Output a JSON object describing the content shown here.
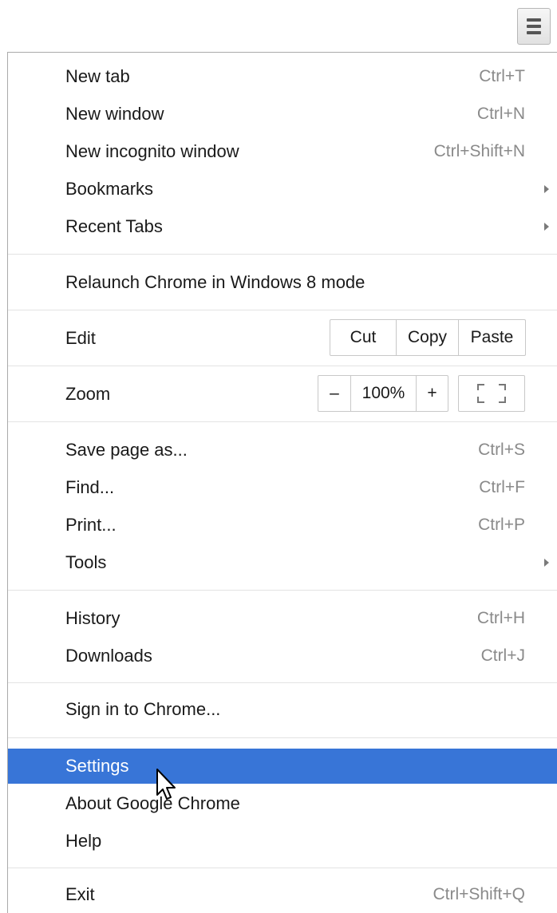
{
  "toolbar": {
    "menu_button": "hamburger-menu"
  },
  "menu": {
    "group1": [
      {
        "label": "New tab",
        "shortcut": "Ctrl+T"
      },
      {
        "label": "New window",
        "shortcut": "Ctrl+N"
      },
      {
        "label": "New incognito window",
        "shortcut": "Ctrl+Shift+N"
      },
      {
        "label": "Bookmarks",
        "submenu": true
      },
      {
        "label": "Recent Tabs",
        "submenu": true
      }
    ],
    "relaunch": {
      "label": "Relaunch Chrome in Windows 8 mode"
    },
    "edit": {
      "label": "Edit",
      "cut": "Cut",
      "copy": "Copy",
      "paste": "Paste"
    },
    "zoom": {
      "label": "Zoom",
      "minus": "–",
      "level": "100%",
      "plus": "+"
    },
    "group2": [
      {
        "label": "Save page as...",
        "shortcut": "Ctrl+S"
      },
      {
        "label": "Find...",
        "shortcut": "Ctrl+F"
      },
      {
        "label": "Print...",
        "shortcut": "Ctrl+P"
      },
      {
        "label": "Tools",
        "submenu": true
      }
    ],
    "group3": [
      {
        "label": "History",
        "shortcut": "Ctrl+H"
      },
      {
        "label": "Downloads",
        "shortcut": "Ctrl+J"
      }
    ],
    "sign_in": {
      "label": "Sign in to Chrome..."
    },
    "group4": [
      {
        "label": "Settings",
        "highlighted": true
      },
      {
        "label": "About Google Chrome"
      },
      {
        "label": "Help"
      }
    ],
    "exit": {
      "label": "Exit",
      "shortcut": "Ctrl+Shift+Q"
    }
  },
  "colors": {
    "highlight": "#3875d7",
    "shortcut_text": "#8a8a8a"
  }
}
